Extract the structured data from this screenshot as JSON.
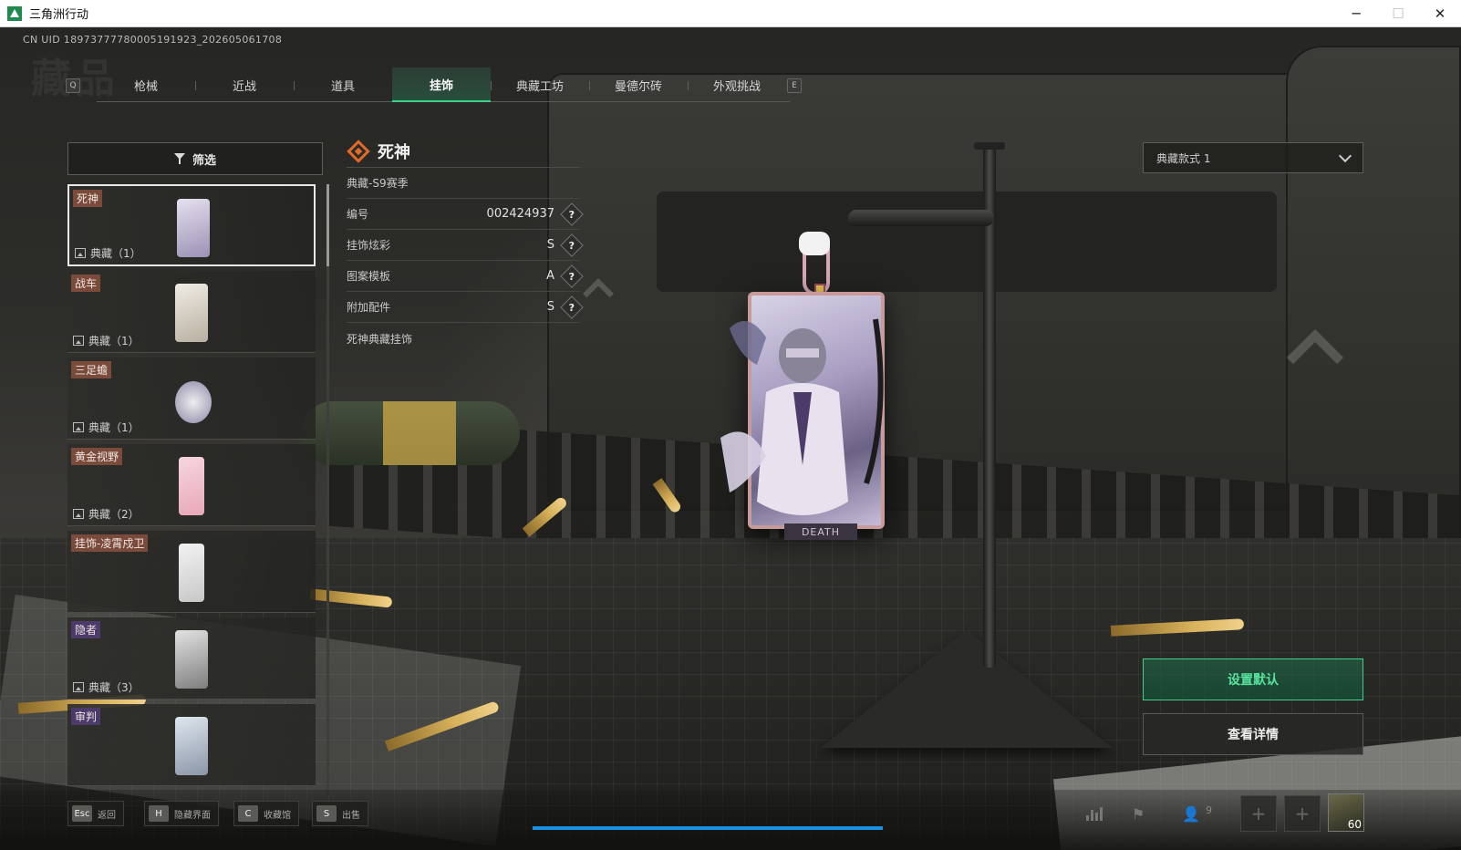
{
  "window": {
    "title": "三角洲行动",
    "minimize": "─",
    "maximize": "☐",
    "close": "✕"
  },
  "uid": "CN UID 18973777780005191923_202605061708",
  "page_title": "藏品",
  "tabs": {
    "prev_key": "Q",
    "next_key": "E",
    "items": [
      "枪械",
      "近战",
      "道具",
      "挂饰",
      "典藏工坊",
      "曼德尔砖",
      "外观挑战"
    ],
    "active_index": 3
  },
  "filter": {
    "label": "筛选"
  },
  "list": [
    {
      "name": "死神",
      "count": "典藏（1）",
      "tag_color": "gold",
      "selected": true
    },
    {
      "name": "战车",
      "count": "典藏（1）",
      "tag_color": "gold"
    },
    {
      "name": "三足蟾",
      "count": "典藏（1）",
      "tag_color": "gold"
    },
    {
      "name": "黄金视野",
      "count": "典藏（2）",
      "tag_color": "gold"
    },
    {
      "name": "挂饰-凌霄戍卫",
      "count": "",
      "tag_color": "gold"
    },
    {
      "name": "隐者",
      "count": "典藏（3）",
      "tag_color": "purple"
    },
    {
      "name": "审判",
      "count": "",
      "tag_color": "purple"
    }
  ],
  "detail": {
    "name": "死神",
    "season": "典藏-S9赛季",
    "rows": [
      {
        "label": "编号",
        "value": "002424937"
      },
      {
        "label": "挂饰炫彩",
        "value": "S"
      },
      {
        "label": "图案模板",
        "value": "A"
      },
      {
        "label": "附加配件",
        "value": "S"
      }
    ],
    "help_glyph": "?",
    "description": "死神典藏挂饰"
  },
  "charm_label": "DEATH",
  "style_select": {
    "value": "典藏款式 1"
  },
  "buttons": {
    "set_default": "设置默认",
    "view_details": "查看详情"
  },
  "hints": [
    {
      "key": "Esc",
      "label": "返回"
    },
    {
      "key": "H",
      "label": "隐藏界面"
    },
    {
      "key": "C",
      "label": "收藏馆"
    },
    {
      "key": "S",
      "label": "出售"
    }
  ],
  "friends_count": "9",
  "slot_plus": "+",
  "player_level": "60",
  "colors": {
    "accent_green": "#3fd18a",
    "tag_gold": "#7a4a3a",
    "tag_purple": "#4b3a6a",
    "progress_blue": "#1d8fe0"
  }
}
